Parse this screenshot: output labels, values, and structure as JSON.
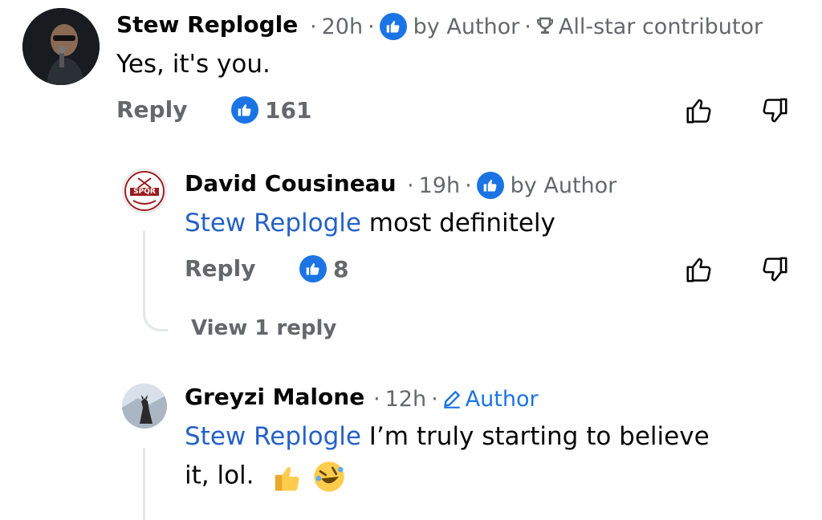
{
  "comments": [
    {
      "author": "Stew Replogle",
      "time": "20h",
      "reaction_badge": "by Author",
      "contributor_badge": "All-star contributor",
      "text": "Yes, it's you.",
      "reply_label": "Reply",
      "like_count": "161"
    },
    {
      "author": "David Cousineau",
      "time": "19h",
      "reaction_badge": "by Author",
      "avatar_text": "SPQR",
      "mention": "Stew Replogle",
      "text": " most definitely",
      "reply_label": "Reply",
      "like_count": "8",
      "view_replies": "View 1 reply"
    },
    {
      "author": "Greyzi Malone",
      "time": "12h",
      "author_badge": "Author",
      "mention": "Stew Replogle",
      "text_line1": " I’m truly starting to believe",
      "text_line2": "it, lol."
    }
  ],
  "icons": [
    "thumbs-up-icon",
    "thumbs-down-icon",
    "trophy-icon",
    "pencil-icon",
    "like-badge-icon"
  ],
  "colors": {
    "accent": "#1b74e4",
    "mention": "#2561c8",
    "meta": "#65676b"
  }
}
